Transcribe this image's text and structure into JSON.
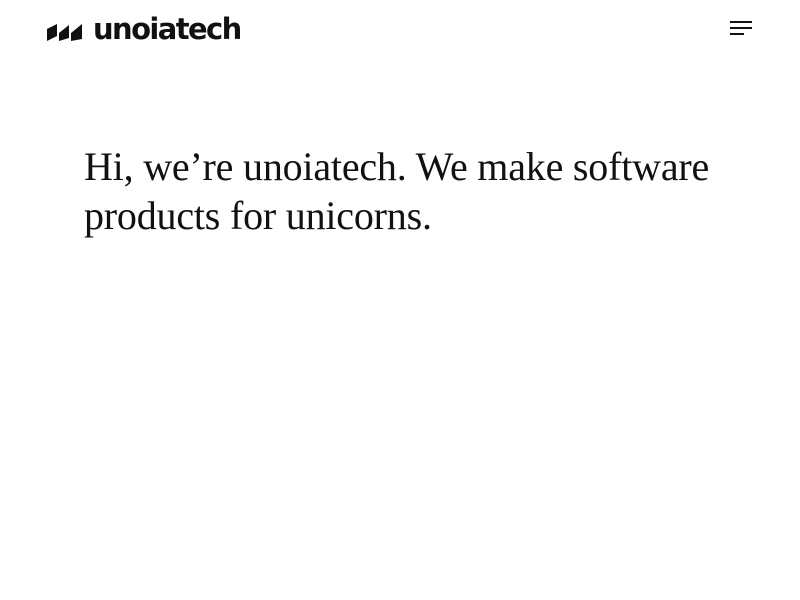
{
  "brand": {
    "name": "unoiatech",
    "text_color": "#111111"
  },
  "header": {
    "menu_icon": "hamburger-menu-icon"
  },
  "hero": {
    "headline": "Hi, we’re unoiatech. We make software products for unicorns."
  },
  "colors": {
    "background": "#ffffff",
    "text": "#111111"
  }
}
